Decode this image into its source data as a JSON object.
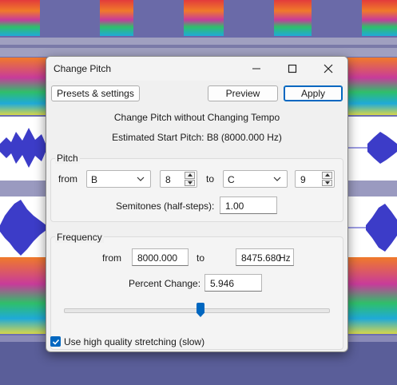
{
  "window": {
    "title": "Change Pitch"
  },
  "toolbar": {
    "presets_label": "Presets & settings",
    "preview_label": "Preview",
    "apply_label": "Apply"
  },
  "header": {
    "heading": "Change Pitch without Changing Tempo",
    "start_pitch": "Estimated Start Pitch: B8 (8000.000 Hz)"
  },
  "pitch": {
    "group_label": "Pitch",
    "from_label": "from",
    "from_note": "B",
    "from_octave": "8",
    "to_label": "to",
    "to_note": "C",
    "to_octave": "9",
    "semitones_label": "Semitones (half-steps):",
    "semitones_value": "1.00"
  },
  "frequency": {
    "group_label": "Frequency",
    "from_label": "from",
    "from_value": "8000.000",
    "to_label": "to",
    "to_value": "8475.680",
    "unit": "Hz",
    "percent_label": "Percent Change:",
    "percent_value": "5.946"
  },
  "options": {
    "high_quality_label": "Use high quality stretching (slow)",
    "high_quality_checked": true
  },
  "colors": {
    "accent": "#0067c0",
    "wave": "#3c3cc8"
  }
}
